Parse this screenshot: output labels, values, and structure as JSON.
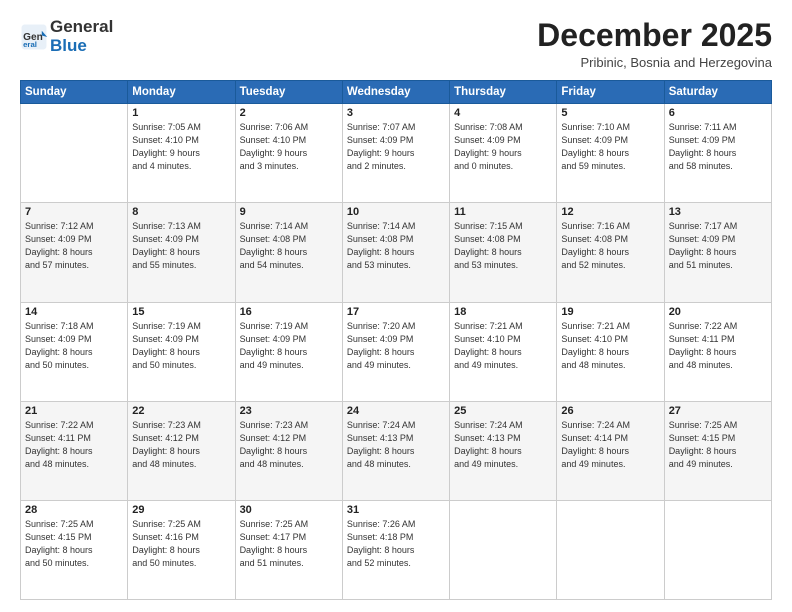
{
  "header": {
    "logo_line1": "General",
    "logo_line2": "Blue",
    "month": "December 2025",
    "location": "Pribinic, Bosnia and Herzegovina"
  },
  "weekdays": [
    "Sunday",
    "Monday",
    "Tuesday",
    "Wednesday",
    "Thursday",
    "Friday",
    "Saturday"
  ],
  "weeks": [
    [
      {
        "day": "",
        "info": ""
      },
      {
        "day": "1",
        "info": "Sunrise: 7:05 AM\nSunset: 4:10 PM\nDaylight: 9 hours\nand 4 minutes."
      },
      {
        "day": "2",
        "info": "Sunrise: 7:06 AM\nSunset: 4:10 PM\nDaylight: 9 hours\nand 3 minutes."
      },
      {
        "day": "3",
        "info": "Sunrise: 7:07 AM\nSunset: 4:09 PM\nDaylight: 9 hours\nand 2 minutes."
      },
      {
        "day": "4",
        "info": "Sunrise: 7:08 AM\nSunset: 4:09 PM\nDaylight: 9 hours\nand 0 minutes."
      },
      {
        "day": "5",
        "info": "Sunrise: 7:10 AM\nSunset: 4:09 PM\nDaylight: 8 hours\nand 59 minutes."
      },
      {
        "day": "6",
        "info": "Sunrise: 7:11 AM\nSunset: 4:09 PM\nDaylight: 8 hours\nand 58 minutes."
      }
    ],
    [
      {
        "day": "7",
        "info": "Sunrise: 7:12 AM\nSunset: 4:09 PM\nDaylight: 8 hours\nand 57 minutes."
      },
      {
        "day": "8",
        "info": "Sunrise: 7:13 AM\nSunset: 4:09 PM\nDaylight: 8 hours\nand 55 minutes."
      },
      {
        "day": "9",
        "info": "Sunrise: 7:14 AM\nSunset: 4:08 PM\nDaylight: 8 hours\nand 54 minutes."
      },
      {
        "day": "10",
        "info": "Sunrise: 7:14 AM\nSunset: 4:08 PM\nDaylight: 8 hours\nand 53 minutes."
      },
      {
        "day": "11",
        "info": "Sunrise: 7:15 AM\nSunset: 4:08 PM\nDaylight: 8 hours\nand 53 minutes."
      },
      {
        "day": "12",
        "info": "Sunrise: 7:16 AM\nSunset: 4:08 PM\nDaylight: 8 hours\nand 52 minutes."
      },
      {
        "day": "13",
        "info": "Sunrise: 7:17 AM\nSunset: 4:09 PM\nDaylight: 8 hours\nand 51 minutes."
      }
    ],
    [
      {
        "day": "14",
        "info": "Sunrise: 7:18 AM\nSunset: 4:09 PM\nDaylight: 8 hours\nand 50 minutes."
      },
      {
        "day": "15",
        "info": "Sunrise: 7:19 AM\nSunset: 4:09 PM\nDaylight: 8 hours\nand 50 minutes."
      },
      {
        "day": "16",
        "info": "Sunrise: 7:19 AM\nSunset: 4:09 PM\nDaylight: 8 hours\nand 49 minutes."
      },
      {
        "day": "17",
        "info": "Sunrise: 7:20 AM\nSunset: 4:09 PM\nDaylight: 8 hours\nand 49 minutes."
      },
      {
        "day": "18",
        "info": "Sunrise: 7:21 AM\nSunset: 4:10 PM\nDaylight: 8 hours\nand 49 minutes."
      },
      {
        "day": "19",
        "info": "Sunrise: 7:21 AM\nSunset: 4:10 PM\nDaylight: 8 hours\nand 48 minutes."
      },
      {
        "day": "20",
        "info": "Sunrise: 7:22 AM\nSunset: 4:11 PM\nDaylight: 8 hours\nand 48 minutes."
      }
    ],
    [
      {
        "day": "21",
        "info": "Sunrise: 7:22 AM\nSunset: 4:11 PM\nDaylight: 8 hours\nand 48 minutes."
      },
      {
        "day": "22",
        "info": "Sunrise: 7:23 AM\nSunset: 4:12 PM\nDaylight: 8 hours\nand 48 minutes."
      },
      {
        "day": "23",
        "info": "Sunrise: 7:23 AM\nSunset: 4:12 PM\nDaylight: 8 hours\nand 48 minutes."
      },
      {
        "day": "24",
        "info": "Sunrise: 7:24 AM\nSunset: 4:13 PM\nDaylight: 8 hours\nand 48 minutes."
      },
      {
        "day": "25",
        "info": "Sunrise: 7:24 AM\nSunset: 4:13 PM\nDaylight: 8 hours\nand 49 minutes."
      },
      {
        "day": "26",
        "info": "Sunrise: 7:24 AM\nSunset: 4:14 PM\nDaylight: 8 hours\nand 49 minutes."
      },
      {
        "day": "27",
        "info": "Sunrise: 7:25 AM\nSunset: 4:15 PM\nDaylight: 8 hours\nand 49 minutes."
      }
    ],
    [
      {
        "day": "28",
        "info": "Sunrise: 7:25 AM\nSunset: 4:15 PM\nDaylight: 8 hours\nand 50 minutes."
      },
      {
        "day": "29",
        "info": "Sunrise: 7:25 AM\nSunset: 4:16 PM\nDaylight: 8 hours\nand 50 minutes."
      },
      {
        "day": "30",
        "info": "Sunrise: 7:25 AM\nSunset: 4:17 PM\nDaylight: 8 hours\nand 51 minutes."
      },
      {
        "day": "31",
        "info": "Sunrise: 7:26 AM\nSunset: 4:18 PM\nDaylight: 8 hours\nand 52 minutes."
      },
      {
        "day": "",
        "info": ""
      },
      {
        "day": "",
        "info": ""
      },
      {
        "day": "",
        "info": ""
      }
    ]
  ]
}
